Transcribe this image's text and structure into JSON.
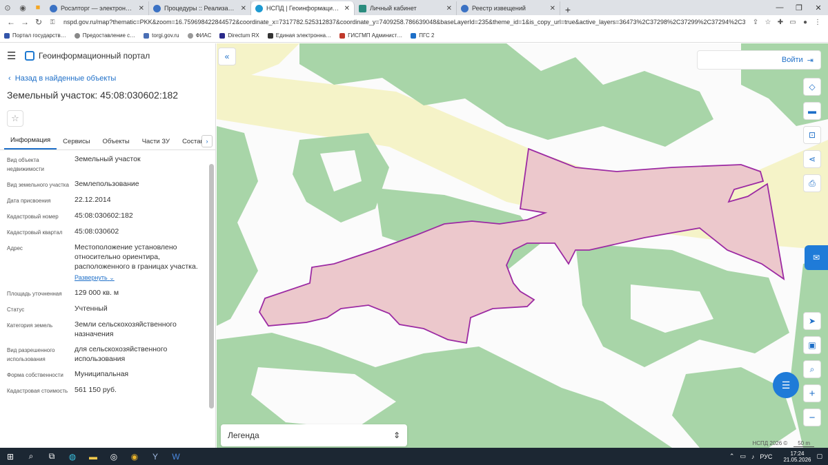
{
  "browser": {
    "tabs": [
      {
        "title": "Росэлторг — электронная торг…",
        "active": false
      },
      {
        "title": "Процедуры :: Реализация госи…",
        "active": false
      },
      {
        "title": "НСПД | Геоинформационный п…",
        "active": true
      },
      {
        "title": "Личный кабинет",
        "active": false
      },
      {
        "title": "Реестр извещений",
        "active": false
      }
    ],
    "url": "nspd.gov.ru/map?thematic=PKK&zoom=16.759698422844572&coordinate_x=7317782.525312837&coordinate_y=7409258.786639048&baseLayerId=235&theme_id=1&is_copy_url=true&active_layers=36473%2C37298%2C37299%2C37294%2C36048&…",
    "bookmarks": [
      "Портал государств…",
      "Предоставление с…",
      "torgi.gov.ru",
      "ФИАС",
      "Directum RX",
      "Единая электронна…",
      "ГИСГМП Админист…",
      "ПГС 2"
    ]
  },
  "app": {
    "title": "Геоинформационный портал"
  },
  "panel": {
    "back_label": "Назад в найденные объекты",
    "title": "Земельный участок: 45:08:030602:182",
    "tabs": [
      "Информация",
      "Сервисы",
      "Объекты",
      "Части ЗУ",
      "Состав"
    ],
    "properties": [
      {
        "key": "Вид объекта недвижимости",
        "value": "Земельный участок"
      },
      {
        "key": "Вид земельного участка",
        "value": "Землепользование"
      },
      {
        "key": "Дата присвоения",
        "value": "22.12.2014"
      },
      {
        "key": "Кадастровый номер",
        "value": "45:08:030602:182"
      },
      {
        "key": "Кадастровый квартал",
        "value": "45:08:030602"
      },
      {
        "key": "Адрес",
        "value": "Местоположение установлено относительно ориентира, расположенного в границах участка."
      },
      {
        "key": "Площадь уточненная",
        "value": "129 000 кв. м"
      },
      {
        "key": "Статус",
        "value": "Учтенный"
      },
      {
        "key": "Категория земель",
        "value": "Земли сельскохозяйственного назначения"
      },
      {
        "key": "Вид разрешенного использования",
        "value": "для сельскохозяйственного использования"
      },
      {
        "key": "Форма собственности",
        "value": "Муниципальная"
      },
      {
        "key": "Кадастровая стоимость",
        "value": "561 150 руб."
      }
    ],
    "expand_label": "Развернуть"
  },
  "map": {
    "login_label": "Войти",
    "legend_label": "Легенда",
    "attribution": "НСПД 2026 ©",
    "scale_label": "50 m",
    "colors": {
      "forest": "#a8d5a8",
      "field": "#f5f3c8",
      "parcel_fill": "#ecc8cc",
      "parcel_stroke": "#9c2aa3"
    }
  },
  "taskbar": {
    "lang": "РУС",
    "time": "17:24",
    "date": "21.05.2026"
  }
}
